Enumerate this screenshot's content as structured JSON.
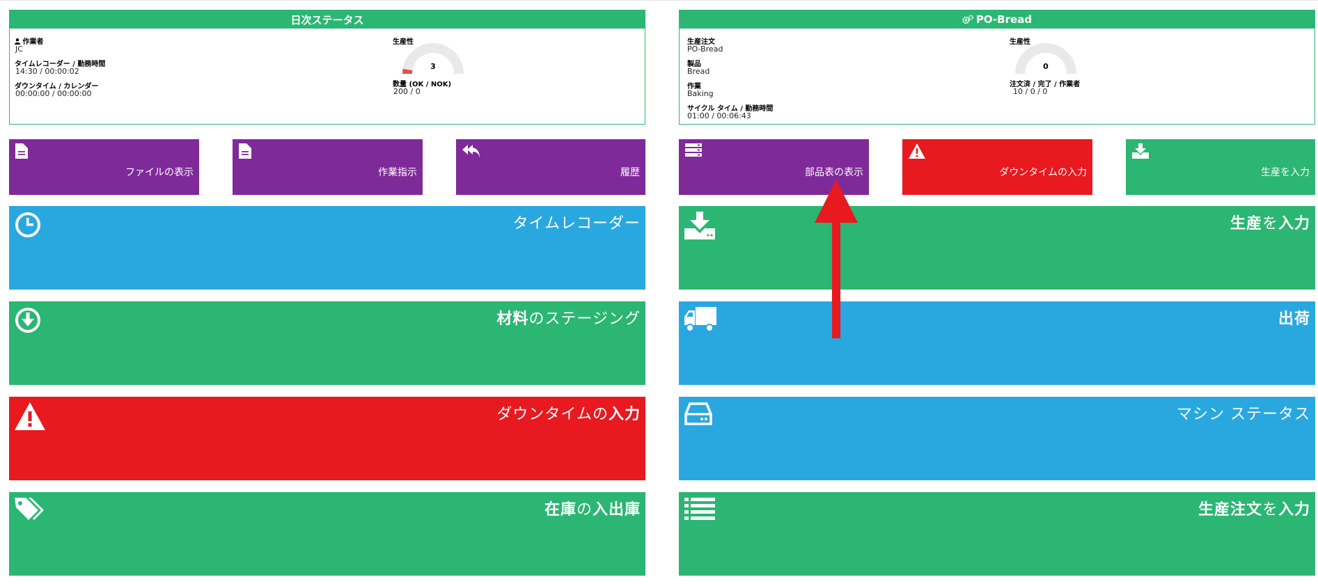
{
  "daily_status": {
    "title": "日次ステータス",
    "operator_label": "作業者",
    "operator_value": "JC",
    "time_recorder_label": "タイムレコーダー / 勤務時間",
    "time_recorder_value": "14:30 / 00:00:02",
    "downtime_label": "ダウンタイム / カレンダー",
    "downtime_value": "00:00:00 / 00:00:00",
    "productivity_label": "生産性",
    "productivity_value": "3",
    "quantity_label": "数量 (OK / NOK)",
    "quantity_value": "200 / 0"
  },
  "po_panel": {
    "title": "PO-Bread",
    "production_order_label": "生産注文",
    "production_order_value": "PO-Bread",
    "product_label": "製品",
    "product_value": "Bread",
    "operation_label": "作業",
    "operation_value": "Baking",
    "cycle_time_label": "サイクル タイム / 勤務時間",
    "cycle_time_value": "01:00 / 00:06:43",
    "productivity_label": "生産性",
    "productivity_value": "0",
    "order_stats_label": "注文済 / 完了 / 作業者",
    "order_stats_value": "10 / 0 / 0"
  },
  "small_tiles": {
    "show_files": "ファイルの表示",
    "work_instructions": "作業指示",
    "history": "履歴",
    "show_bom": "部品表の表示",
    "enter_downtime": "ダウンタイムの入力",
    "enter_production": "生産を入力"
  },
  "big_tiles": {
    "time_recorder": "タイムレコーダー",
    "staging_a": "材料",
    "staging_b": "のステージング",
    "downtime_a": "ダウンタイムの",
    "downtime_b": "入力",
    "inventory_a": "在庫",
    "inventory_b": "の",
    "inventory_c": "入出庫",
    "production_a": "生産",
    "production_b": "を",
    "production_c": "入力",
    "shipping": "出荷",
    "machine_status": "マシン ステータス",
    "order_entry_a": "生産注文",
    "order_entry_b": "を",
    "order_entry_c": "入力"
  },
  "colors": {
    "green": "#2bb673",
    "purple": "#7f2a99",
    "red": "#e8191f",
    "blue": "#29a8e0",
    "annotation_arrow": "#e8191f"
  }
}
